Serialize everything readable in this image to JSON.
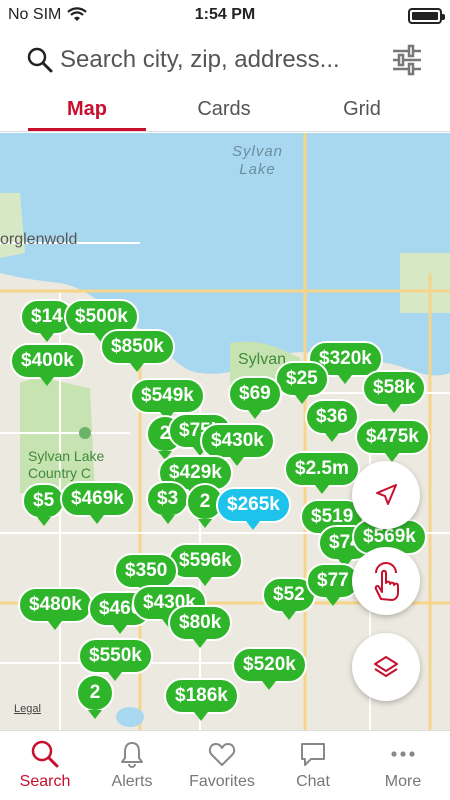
{
  "status": {
    "carrier": "No SIM",
    "time": "1:54 PM"
  },
  "search": {
    "placeholder": "Search city, zip, address..."
  },
  "tabs": [
    {
      "label": "Map",
      "active": true
    },
    {
      "label": "Cards",
      "active": false
    },
    {
      "label": "Grid",
      "active": false
    }
  ],
  "map": {
    "labels": {
      "lake": "Sylvan\nLake",
      "town_west": "orglenwold",
      "park": "Sylvan",
      "golf": "Sylvan Lake\nCountry C",
      "legal": "Legal"
    },
    "pins": [
      {
        "label": "$14"
      },
      {
        "label": "$500k"
      },
      {
        "label": "$850k"
      },
      {
        "label": "$400k"
      },
      {
        "label": "$549k"
      },
      {
        "label": "$320k"
      },
      {
        "label": "$25"
      },
      {
        "label": "$69"
      },
      {
        "label": "$58k"
      },
      {
        "label": "2"
      },
      {
        "label": "$75k"
      },
      {
        "label": "$430k"
      },
      {
        "label": "$2.5m"
      },
      {
        "label": "$36"
      },
      {
        "label": "$475k"
      },
      {
        "label": "$429k"
      },
      {
        "label": "$5"
      },
      {
        "label": "$469k"
      },
      {
        "label": "$3"
      },
      {
        "label": "2"
      },
      {
        "label": "$265k"
      },
      {
        "label": "$519"
      },
      {
        "label": "$74"
      },
      {
        "label": "$569k"
      },
      {
        "label": "$596k"
      },
      {
        "label": "$350"
      },
      {
        "label": "$480k"
      },
      {
        "label": "$460"
      },
      {
        "label": "$430k"
      },
      {
        "label": "$80k"
      },
      {
        "label": "$52"
      },
      {
        "label": "$77"
      },
      {
        "label": "$550k"
      },
      {
        "label": "$520k"
      },
      {
        "label": "2"
      },
      {
        "label": "$186k"
      }
    ]
  },
  "nav": [
    {
      "label": "Search",
      "icon": "search-icon",
      "active": true
    },
    {
      "label": "Alerts",
      "icon": "bell-icon",
      "active": false
    },
    {
      "label": "Favorites",
      "icon": "heart-icon",
      "active": false
    },
    {
      "label": "Chat",
      "icon": "chat-icon",
      "active": false
    },
    {
      "label": "More",
      "icon": "more-icon",
      "active": false
    }
  ],
  "colors": {
    "accent": "#c8102e",
    "pin": "#2fb52a",
    "pin_selected": "#1ec3ec",
    "water": "#a8d8ef",
    "park": "#c7e3b1"
  }
}
